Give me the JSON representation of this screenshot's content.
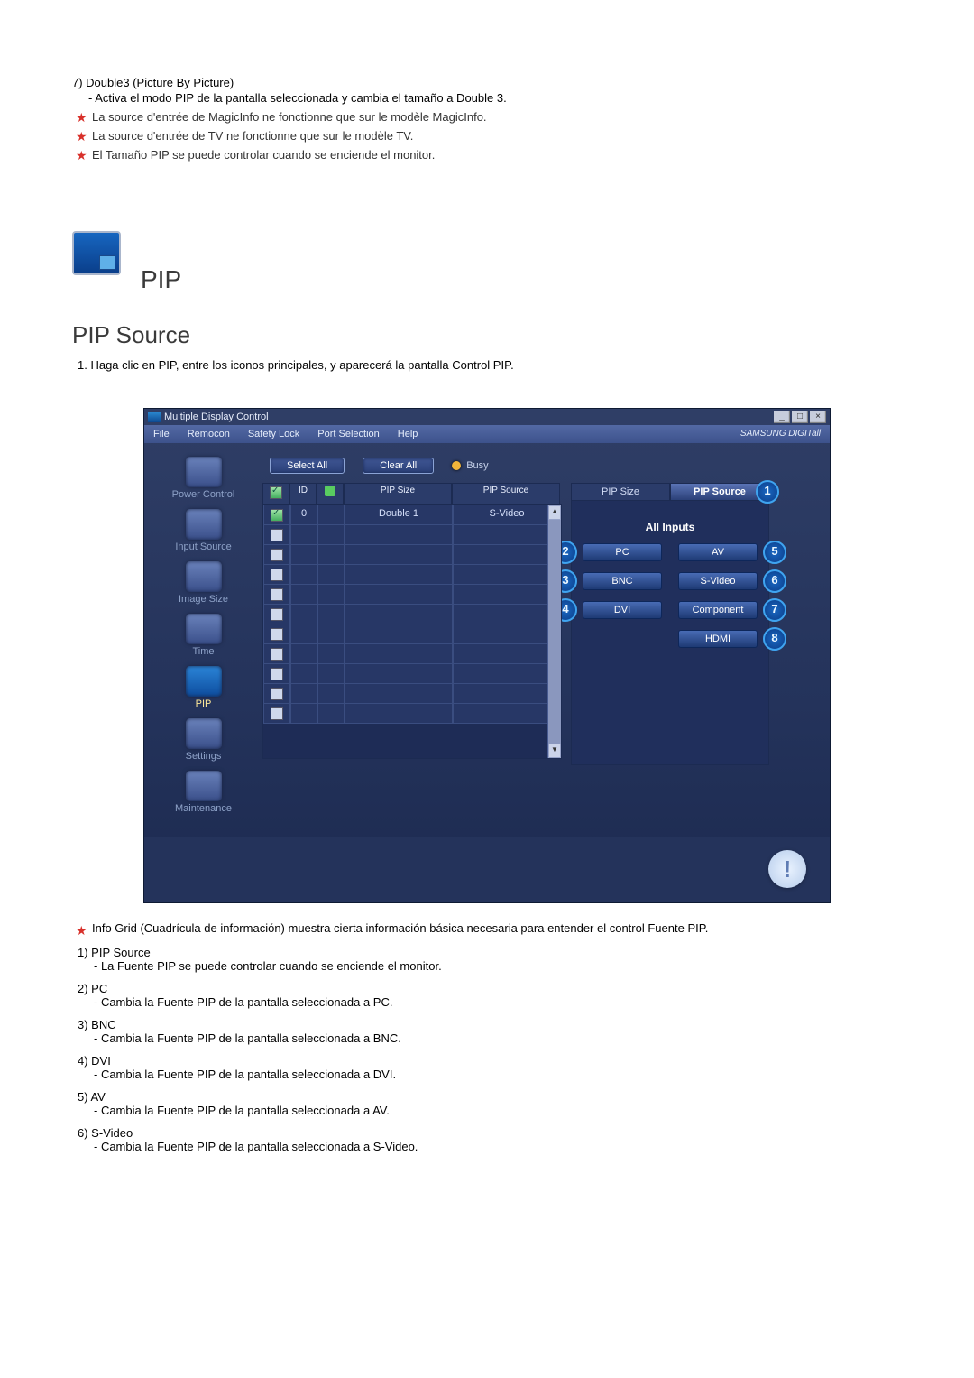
{
  "intro": {
    "item7_title": "7)  Double3 (Picture By Picture)",
    "item7_desc": "- Activa el modo PIP de la pantalla seleccionada y cambia el tamaño a Double 3.",
    "star1": "La source d'entrée de MagicInfo ne fonctionne que sur le modèle MagicInfo.",
    "star2": "La source d'entrée de TV ne fonctionne que sur le modèle TV.",
    "star3": "El Tamaño PIP se puede controlar cuando se enciende el monitor."
  },
  "headings": {
    "pip": "PIP",
    "source": "PIP Source",
    "intro_line": "1.  Haga clic en PIP, entre los iconos principales, y aparecerá la pantalla Control PIP."
  },
  "app": {
    "title": "Multiple Display Control",
    "menus": [
      "File",
      "Remocon",
      "Safety Lock",
      "Port Selection",
      "Help"
    ],
    "brand": "SAMSUNG DIGITall",
    "select_all": "Select All",
    "clear_all": "Clear All",
    "busy": "Busy",
    "sidebar": [
      "Power Control",
      "Input Source",
      "Image Size",
      "Time",
      "PIP",
      "Settings",
      "Maintenance"
    ],
    "active_sidebar": "PIP",
    "grid_headers": {
      "chk": "",
      "id": "ID",
      "st": "",
      "size": "PIP Size",
      "source": "PIP Source"
    },
    "row0": {
      "id": "0",
      "size": "Double 1",
      "source": "S-Video"
    },
    "tab_size": "PIP Size",
    "tab_source": "PIP Source",
    "all_inputs": "All Inputs",
    "left_opts": [
      "PC",
      "BNC",
      "DVI"
    ],
    "right_opts": [
      "AV",
      "S-Video",
      "Component",
      "HDMI"
    ],
    "nums_left": [
      "2",
      "3",
      "4"
    ],
    "nums_right": [
      "5",
      "6",
      "7",
      "8"
    ],
    "num_tab": "1"
  },
  "notes": {
    "grid_note": "Info Grid (Cuadrícula de información) muestra cierta información básica necesaria para entender el control Fuente PIP.",
    "items": [
      {
        "t": "1)  PIP Source",
        "d": "- La Fuente PIP se puede controlar cuando se enciende el monitor."
      },
      {
        "t": "2)  PC",
        "d": "- Cambia la Fuente PIP de la pantalla seleccionada a PC."
      },
      {
        "t": "3)  BNC",
        "d": "- Cambia la Fuente PIP de la pantalla seleccionada a BNC."
      },
      {
        "t": "4)  DVI",
        "d": "- Cambia la Fuente PIP de la pantalla seleccionada a DVI."
      },
      {
        "t": "5)  AV",
        "d": "- Cambia la Fuente PIP de la pantalla seleccionada a AV."
      },
      {
        "t": "6)  S-Video",
        "d": "- Cambia la Fuente PIP de la pantalla seleccionada a S-Video."
      }
    ]
  }
}
